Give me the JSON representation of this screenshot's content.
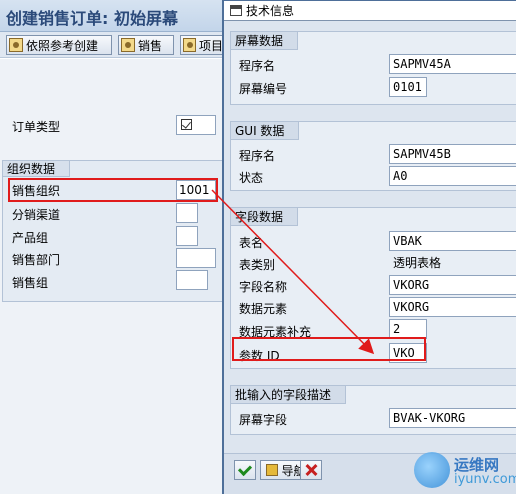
{
  "screen": {
    "title": "创建销售订单: 初始屏幕",
    "toolbar": {
      "btn_reference": "依照参考创建",
      "btn_sales": "销售",
      "btn_item": "项目"
    },
    "fields": {
      "order_type_label": "订单类型",
      "org_group_title": "组织数据",
      "sales_org_label": "销售组织",
      "sales_org_value": "1001",
      "dist_channel_label": "分销渠道",
      "division_label": "产品组",
      "sales_office_label": "销售部门",
      "sales_group_label": "销售组"
    }
  },
  "dialog": {
    "title": "技术信息",
    "screen_data": {
      "title": "屏幕数据",
      "program_label": "程序名",
      "program_value": "SAPMV45A",
      "screen_no_label": "屏幕编号",
      "screen_no_value": "0101"
    },
    "gui_data": {
      "title": "GUI 数据",
      "program_label": "程序名",
      "program_value": "SAPMV45B",
      "status_label": "状态",
      "status_value": "A0"
    },
    "field_data": {
      "title": "字段数据",
      "table_label": "表名",
      "table_value": "VBAK",
      "table_cat_label": "表类别",
      "table_cat_value": "透明表格",
      "field_label": "字段名称",
      "field_value": "VKORG",
      "data_elem_label": "数据元素",
      "data_elem_value": "VKORG",
      "de_supp_label": "数据元素补充",
      "de_supp_value": "2",
      "param_label": "参数 ID",
      "param_value": "VKO"
    },
    "batch_input": {
      "title": "批输入的字段描述",
      "screen_field_label": "屏幕字段",
      "screen_field_value": "BVAK-VKORG"
    },
    "footer": {
      "nav_label": "导航"
    }
  },
  "watermark": {
    "line1": "运维网",
    "line2": "iyunv.com"
  },
  "colors": {
    "highlight": "#e01b1b",
    "accent": "#4e6f99"
  }
}
